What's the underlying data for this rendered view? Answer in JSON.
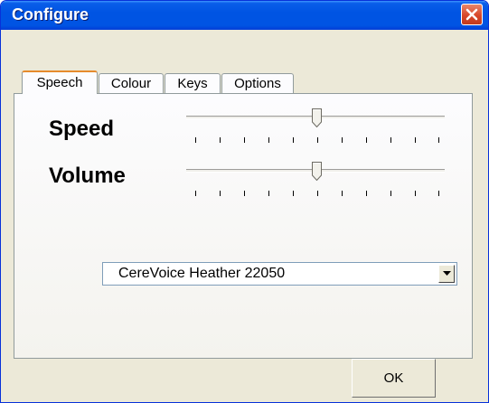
{
  "window": {
    "title": "Configure",
    "close_icon": "close-icon",
    "title_bar_color": "#0054e3",
    "close_button_color": "#d8482b"
  },
  "tabs": [
    {
      "label": "Speech",
      "active": true
    },
    {
      "label": "Colour",
      "active": false
    },
    {
      "label": "Keys",
      "active": false
    },
    {
      "label": "Options",
      "active": false
    }
  ],
  "speech": {
    "speed": {
      "label": "Speed",
      "position": 0.5
    },
    "volume": {
      "label": "Volume",
      "position": 0.5
    },
    "voice": {
      "selected": "CereVoice Heather 22050",
      "dropdown_icon": "chevron-down-icon"
    }
  },
  "buttons": {
    "ok": "OK"
  }
}
